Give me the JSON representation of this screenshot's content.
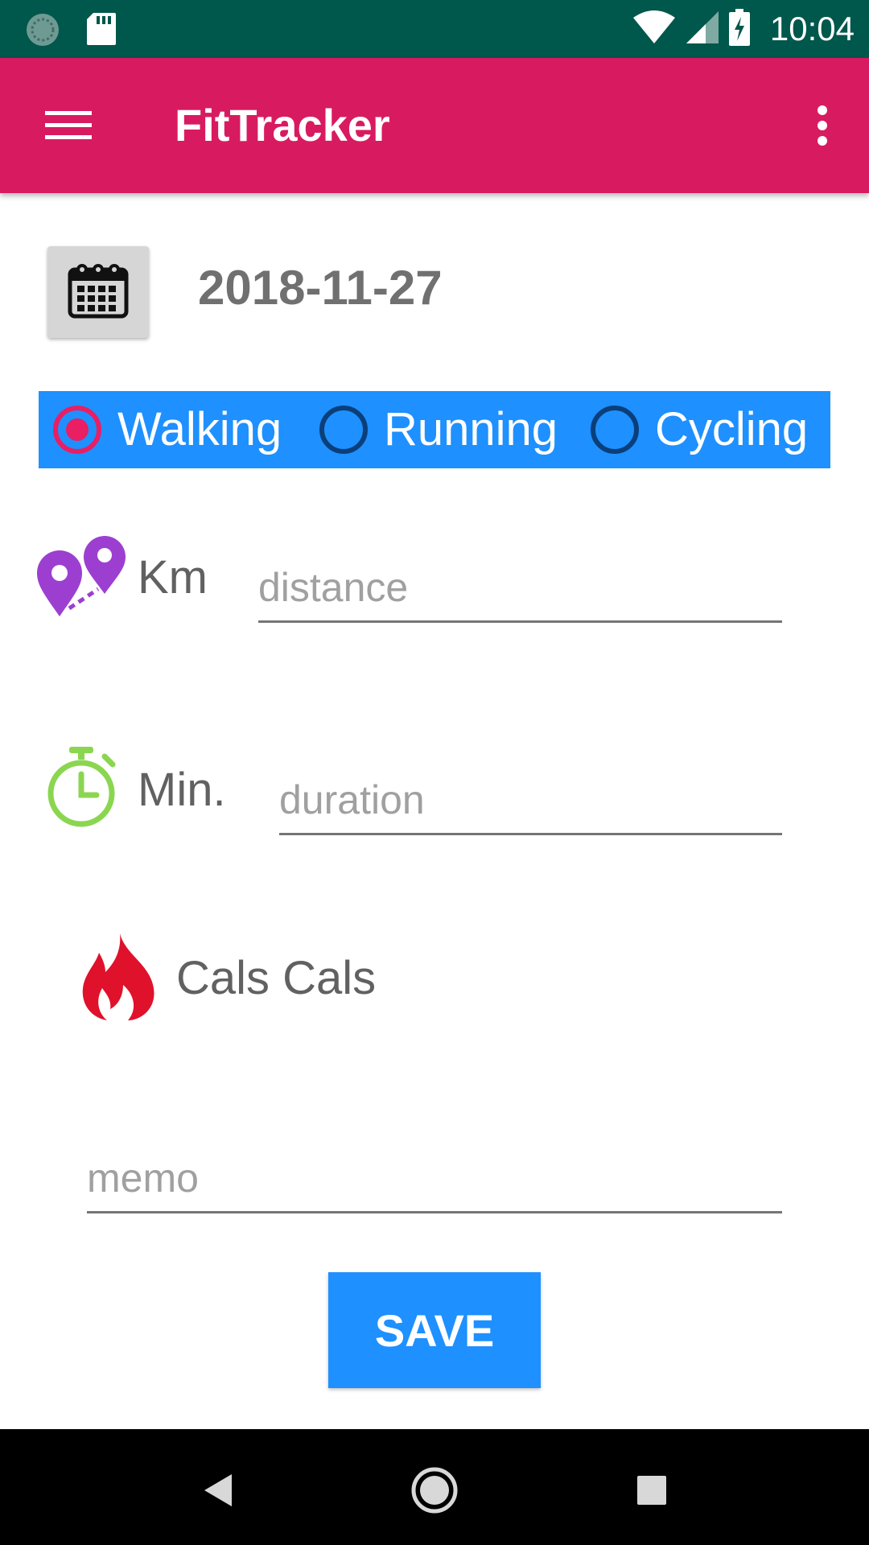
{
  "status_bar": {
    "time": "10:04",
    "icons": [
      "sync-icon",
      "sd-card-icon",
      "wifi-icon",
      "cell-signal-icon",
      "battery-charging-icon"
    ]
  },
  "app_bar": {
    "title": "FitTracker",
    "menu_icon": "hamburger-menu-icon",
    "overflow_icon": "more-vert-icon",
    "color": "#d81b60"
  },
  "date": {
    "value": "2018-11-27",
    "icon": "calendar-icon"
  },
  "activity": {
    "background": "#1e90ff",
    "options": [
      {
        "label": "Walking",
        "checked": true
      },
      {
        "label": "Running",
        "checked": false
      },
      {
        "label": "Cycling",
        "checked": false
      }
    ]
  },
  "distance": {
    "unit_label": "Km",
    "placeholder": "distance",
    "value": "",
    "icon": "map-pins-route-icon"
  },
  "duration": {
    "unit_label": "Min.",
    "placeholder": "duration",
    "value": "",
    "icon": "stopwatch-icon"
  },
  "calories": {
    "label": "Cals Cals",
    "icon": "flame-icon"
  },
  "memo": {
    "placeholder": "memo",
    "value": ""
  },
  "save": {
    "label": "SAVE",
    "color": "#1e90ff"
  },
  "nav_bar": {
    "icons": [
      "back-icon",
      "home-icon",
      "recents-icon"
    ]
  }
}
